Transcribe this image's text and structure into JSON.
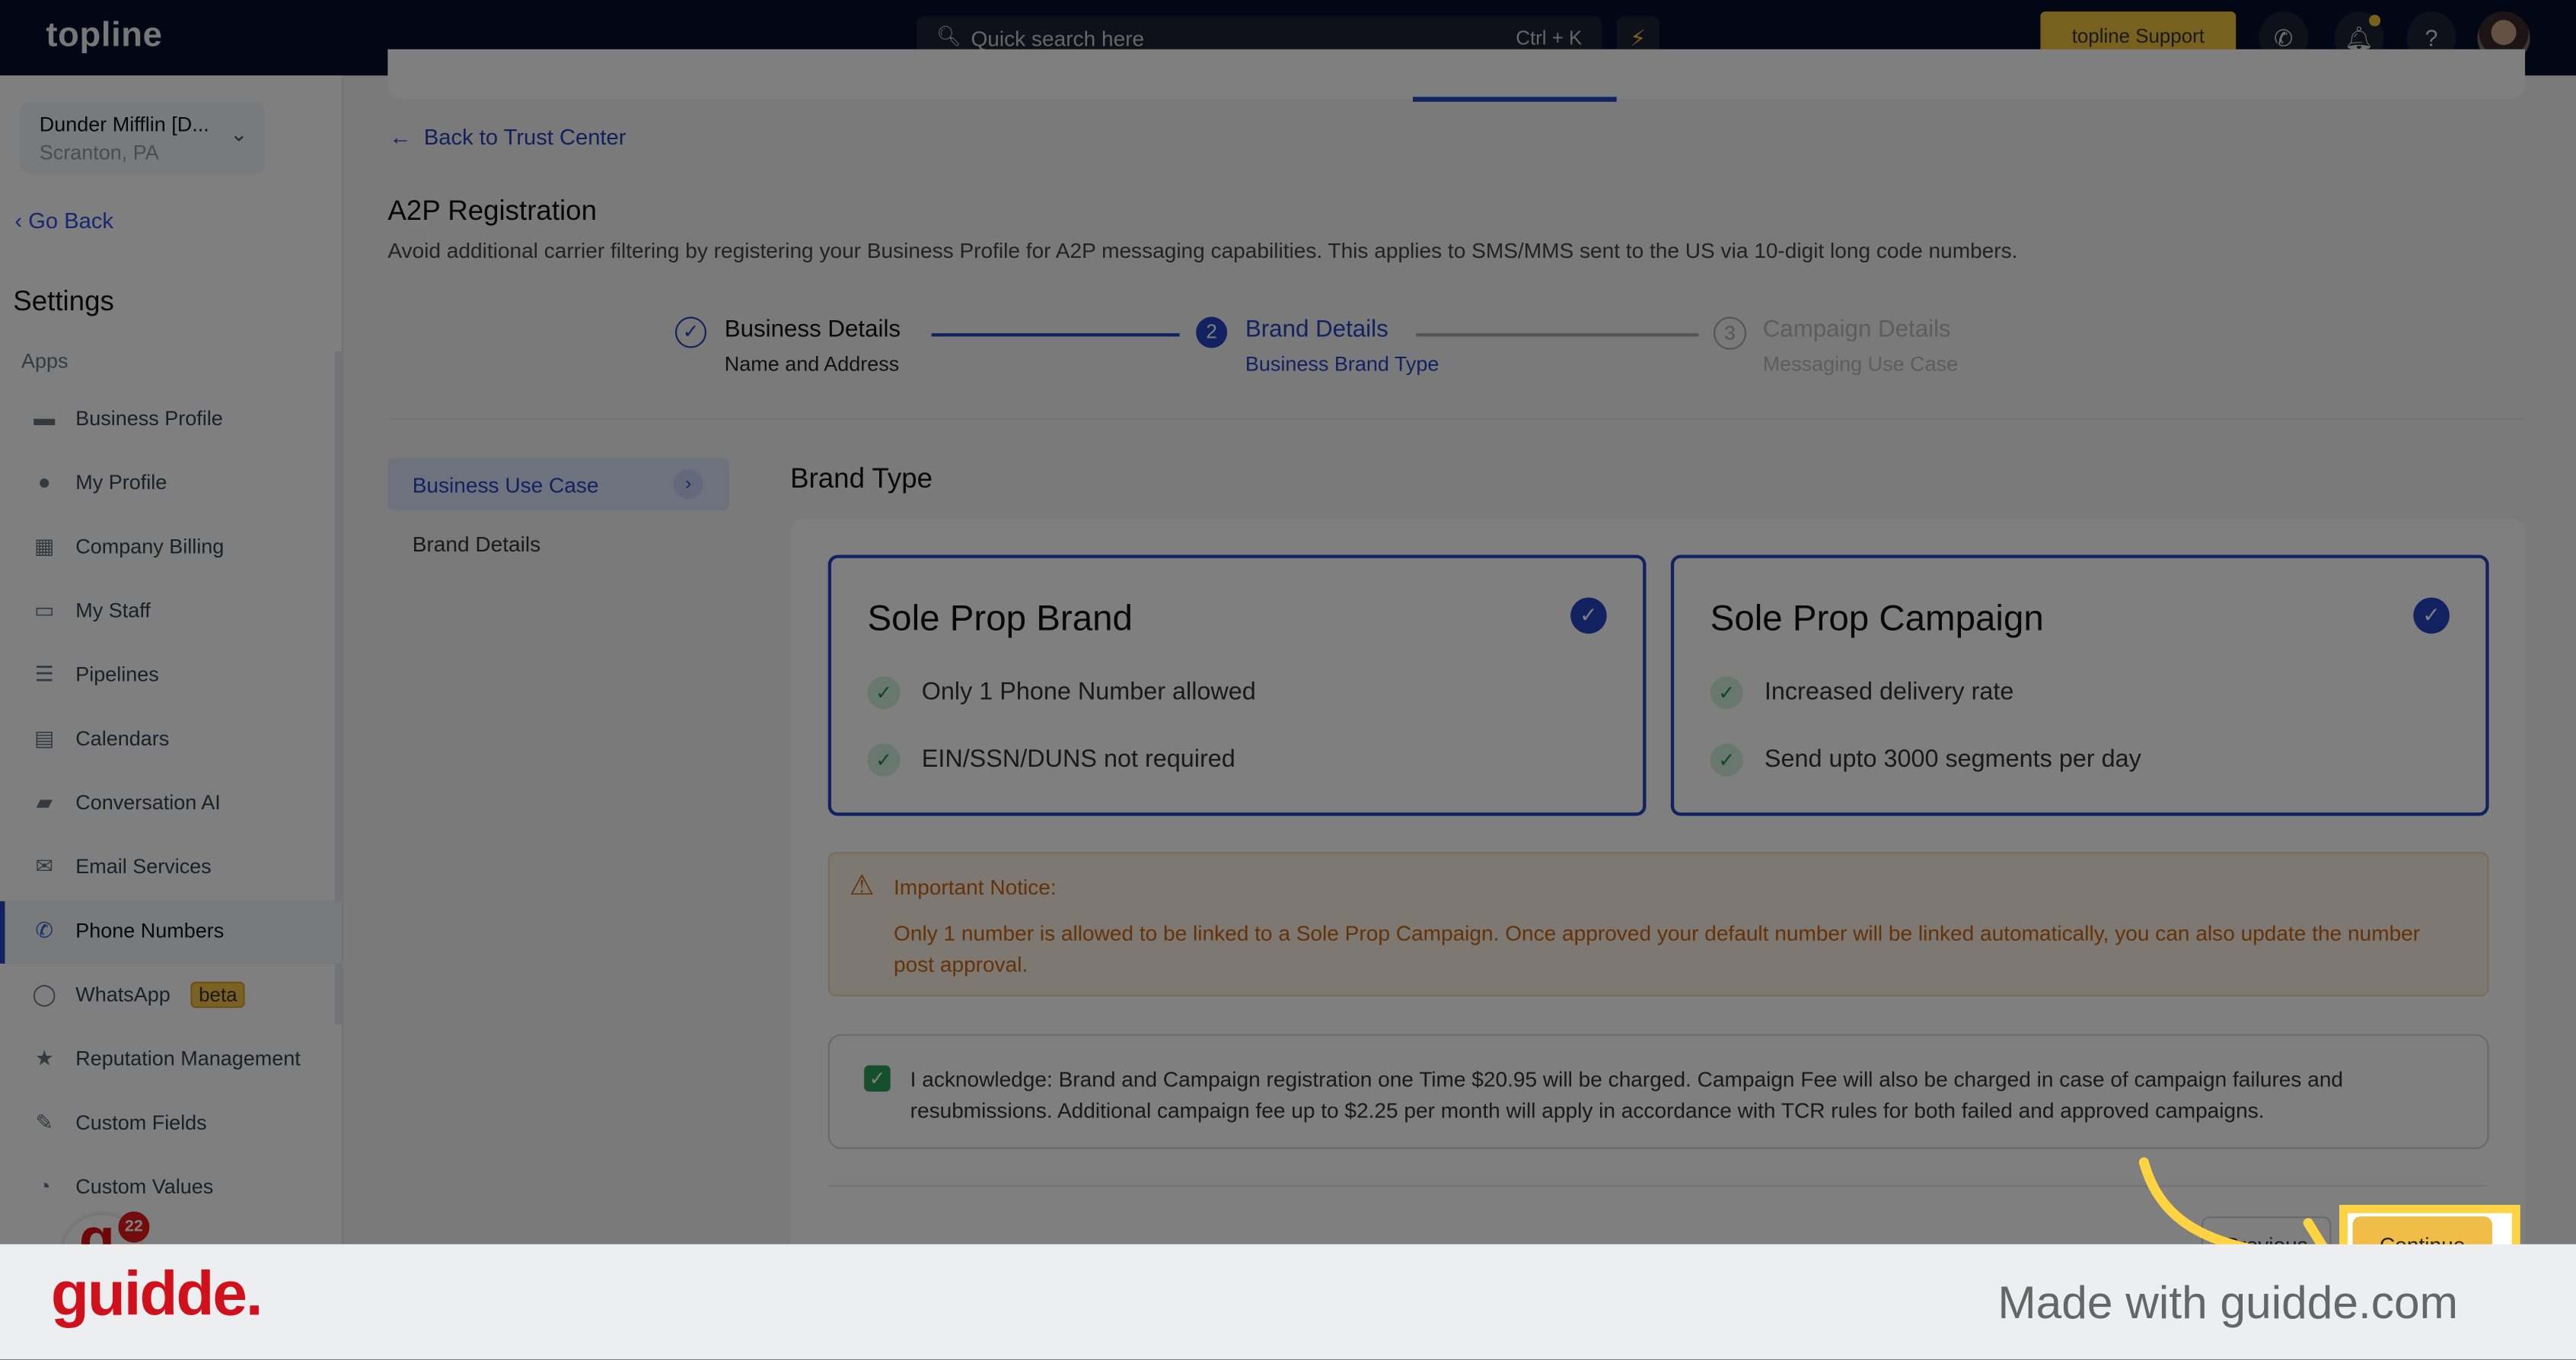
{
  "header": {
    "logo": "topline",
    "search_placeholder": "Quick search here",
    "search_shortcut": "Ctrl + K",
    "support_label": "topline Support"
  },
  "sidebar": {
    "account_name": "Dunder Mifflin [D...",
    "account_location": "Scranton, PA",
    "go_back": "Go Back",
    "settings_title": "Settings",
    "section": "Apps",
    "items": [
      {
        "label": "Business Profile",
        "icon": "briefcase-icon"
      },
      {
        "label": "My Profile",
        "icon": "user-icon"
      },
      {
        "label": "Company Billing",
        "icon": "grid-icon"
      },
      {
        "label": "My Staff",
        "icon": "inbox-icon"
      },
      {
        "label": "Pipelines",
        "icon": "filter-icon"
      },
      {
        "label": "Calendars",
        "icon": "calendar-icon"
      },
      {
        "label": "Conversation AI",
        "icon": "chat-icon"
      },
      {
        "label": "Email Services",
        "icon": "mail-icon"
      },
      {
        "label": "Phone Numbers",
        "icon": "phone-icon",
        "active": true
      },
      {
        "label": "WhatsApp",
        "icon": "whatsapp-icon",
        "badge": "beta"
      },
      {
        "label": "Reputation Management",
        "icon": "star-icon"
      },
      {
        "label": "Custom Fields",
        "icon": "edit-icon"
      },
      {
        "label": "Custom Values",
        "icon": "pie-icon"
      }
    ],
    "help_badge_count": "22"
  },
  "main": {
    "back_link": "Back to Trust Center",
    "title": "A2P Registration",
    "description": "Avoid additional carrier filtering by registering your Business Profile for A2P messaging capabilities. This applies to SMS/MMS sent to the US via 10-digit long code numbers.",
    "steps": [
      {
        "marker": "✓",
        "title": "Business Details",
        "subtitle": "Name and Address",
        "state": "done"
      },
      {
        "marker": "2",
        "title": "Brand Details",
        "subtitle": "Business Brand Type",
        "state": "active"
      },
      {
        "marker": "3",
        "title": "Campaign Details",
        "subtitle": "Messaging Use Case",
        "state": "pending"
      }
    ],
    "nav": {
      "business_use_case": "Business Use Case",
      "brand_details": "Brand Details"
    },
    "brand_type_heading": "Brand Type",
    "cards": [
      {
        "title": "Sole Prop Brand",
        "features": [
          "Only 1 Phone Number allowed",
          "EIN/SSN/DUNS not required"
        ],
        "selected": true
      },
      {
        "title": "Sole Prop Campaign",
        "features": [
          "Increased delivery rate",
          "Send upto 3000 segments per day"
        ],
        "selected": true
      }
    ],
    "notice": {
      "title": "Important Notice:",
      "body": "Only 1 number is allowed to be linked to a Sole Prop Campaign. Once approved your default number will be linked automatically, you can also update the number post approval."
    },
    "acknowledge": {
      "checked": true,
      "text": "I acknowledge: Brand and Campaign registration one Time $20.95 will be charged. Campaign Fee will also be charged in case of campaign failures and resubmissions. Additional campaign fee up to $2.25 per month will apply in accordance with TCR rules for both failed and approved campaigns."
    },
    "previous_label": "Previous",
    "continue_label": "Continue"
  },
  "footer": {
    "brand": "guidde.",
    "made_with": "Made with guidde.com"
  },
  "colors": {
    "accent": "#2545c0",
    "highlight": "#ffd341",
    "notice": "#c8640e",
    "footer_brand": "#d0101a"
  }
}
